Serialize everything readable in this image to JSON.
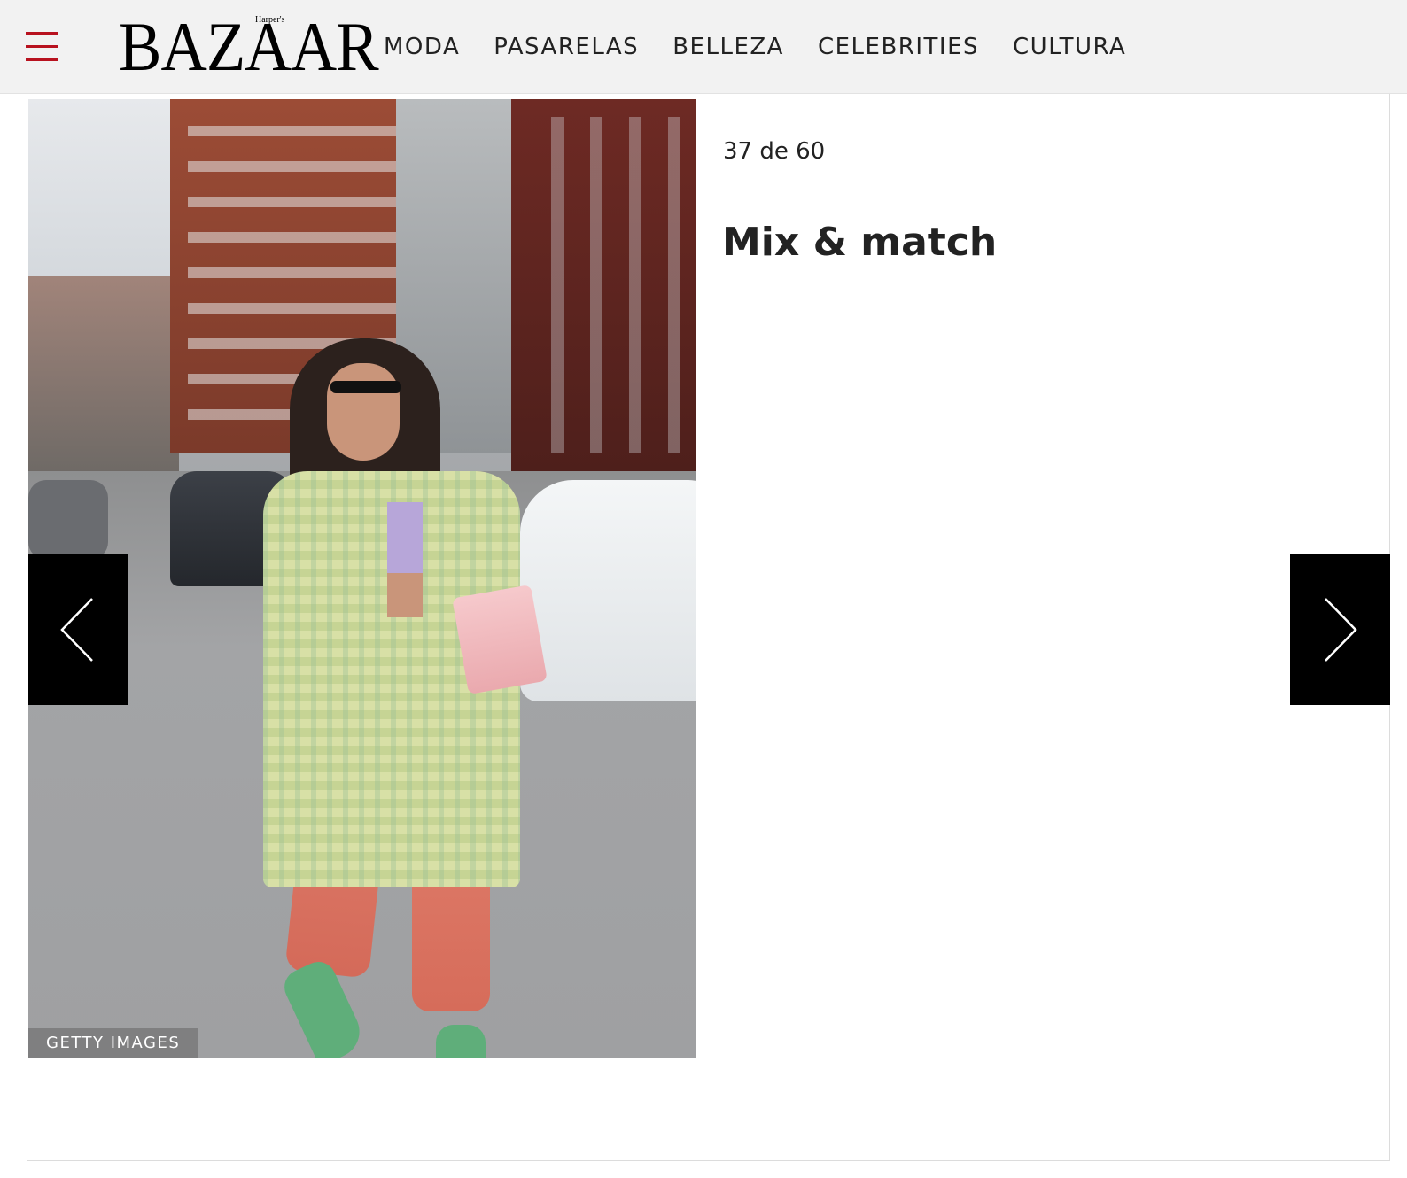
{
  "header": {
    "logo": {
      "wordmark": "BAZAAR",
      "small_mark": "Harper's"
    },
    "nav": [
      "MODA",
      "PASARELAS",
      "BELLEZA",
      "CELEBRITIES",
      "CULTURA"
    ]
  },
  "gallery": {
    "counter": "37 de 60",
    "title": "Mix & match",
    "photo_credit": "GETTY IMAGES"
  },
  "icons": {
    "menu": "hamburger-icon",
    "prev": "chevron-left-icon",
    "next": "chevron-right-icon"
  },
  "colors": {
    "accent": "#b8121f",
    "header_bg": "#f2f2f2",
    "arrow_bg": "#000000",
    "text": "#222222"
  }
}
